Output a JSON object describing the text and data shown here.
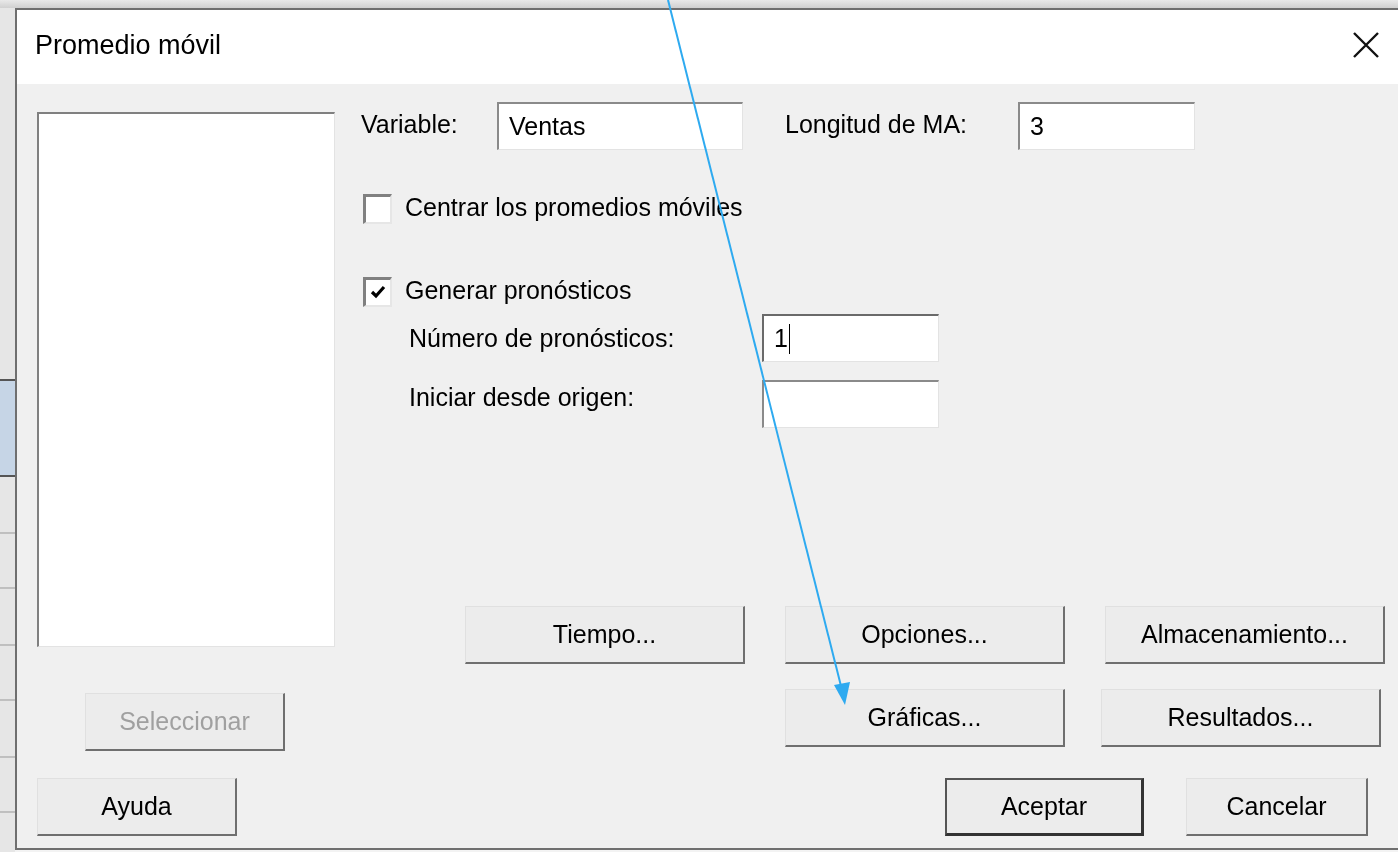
{
  "window": {
    "title": "Promedio móvil"
  },
  "fields": [
    {
      "label": "Variable:",
      "value": "Ventas",
      "focused": false
    },
    {
      "label": "Longitud de MA:",
      "value": "3",
      "focused": false
    }
  ],
  "options": [
    {
      "label": "Centrar los promedios móviles",
      "checked": false
    },
    {
      "label": "Generar pronósticos",
      "checked": true
    }
  ],
  "forecast_fields": [
    {
      "label": "Número de pronósticos:",
      "value": "1",
      "focused": true
    },
    {
      "label": "Iniciar desde origen:",
      "focused": false
    }
  ],
  "select_button": {
    "label": "Seleccionar",
    "disabled": true
  },
  "option_button_rows": [
    {
      "buttons": [
        {
          "label": "Tiempo..."
        },
        {
          "label": "Opciones..."
        },
        {
          "label": "Almacenamiento..."
        }
      ]
    },
    {
      "buttons": [
        {
          "label": "Gráficas..."
        },
        {
          "label": "Resultados..."
        }
      ]
    }
  ],
  "footer_buttons": [
    {
      "label": "Ayuda",
      "default": false
    },
    {
      "label": "Aceptar",
      "default": true
    },
    {
      "label": "Cancelar",
      "default": false
    }
  ]
}
